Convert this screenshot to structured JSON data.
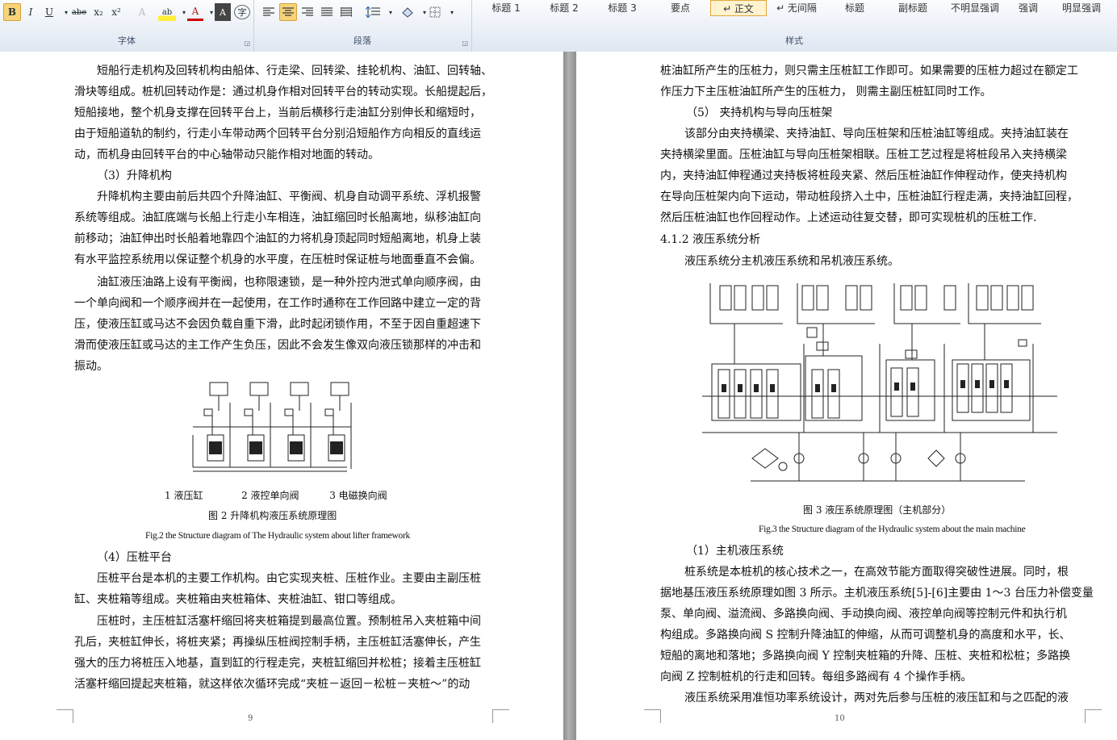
{
  "ribbon": {
    "font_group": {
      "label": "字体",
      "buttons": [
        "B",
        "I",
        "U",
        "abe",
        "x₂",
        "x²",
        "A",
        "ab",
        "A",
        "A",
        "字"
      ]
    },
    "paragraph_group": {
      "label": "段落"
    },
    "styles_group": {
      "label": "样式",
      "items": [
        "标题 1",
        "标题 2",
        "标题 3",
        "要点",
        "↵ 正文",
        "↵ 无间隔",
        "标题",
        "副标题",
        "不明显强调",
        "强调",
        "明显强调"
      ],
      "active_index": 4
    }
  },
  "left_page": {
    "lines": [
      "短船行走机构及回转机构由船体、行走梁、回转梁、挂轮机构、油缸、回转轴、",
      "滑块等组成。桩机回转动作是：通过机身作相对回转平台的转动实现。长船提起后，",
      "短船接地，整个机身支撑在回转平台上，当前后横移行走油缸分别伸长和缩短时，",
      "由于短船道轨的制约，行走小车带动两个回转平台分别沿短船作方向相反的直线运",
      "动，而机身由回转平台的中心轴带动只能作相对地面的转动。",
      "（3）升降机构",
      "升降机构主要由前后共四个升降油缸、平衡阀、机身自动调平系统、浮机报警",
      "系统等组成。油缸底端与长船上行走小车相连，油缸缩回时长船离地，纵移油缸向",
      "前移动；油缸伸出时长船着地靠四个油缸的力将机身顶起同时短船离地，机身上装",
      "有水平监控系统用以保证整个机身的水平度，在压桩时保证桩与地面垂直不会偏。",
      "油缸液压油路上设有平衡阀，也称限速锁，是一种外控内泄式单向顺序阀，由",
      "一个单向阀和一个顺序阀并在一起使用，在工作时通称在工作回路中建立一定的背",
      "压，使液压缸或马达不会因负载自重下滑，此时起闭锁作用，不至于因自重超速下",
      "滑而使液压缸或马达的主工作产生负压，因此不会发生像双向液压锁那样的冲击和",
      "振动。"
    ],
    "figure_legend": [
      "1  液压缸",
      "2  液控单向阀",
      "3  电磁换向阀"
    ],
    "figure_caption_cn": "图 2  升降机构液压系统原理图",
    "figure_caption_en": "Fig.2 the Structure diagram of The Hydraulic system about lifter framework",
    "lines_after": [
      "（4）压桩平台",
      "压桩平台是本机的主要工作机构。由它实现夹桩、压桩作业。主要由主副压桩",
      "缸、夹桩箱等组成。夹桩箱由夹桩箱体、夹桩油缸、钳口等组成。",
      "压桩时，主压桩缸活塞杆缩回将夹桩箱提到最高位置。预制桩吊入夹桩箱中间",
      "孔后，夹桩缸伸长，将桩夹紧；再操纵压桩阀控制手柄，主压桩缸活塞伸长，产生",
      "强大的压力将桩压入地基，直到缸的行程走完，夹桩缸缩回并松桩；接着主压桩缸",
      "活塞杆缩回提起夹桩箱，就这样依次循环完成“夹桩－返回－松桩－夹桩～”的动"
    ],
    "page_number": "9"
  },
  "right_page": {
    "lines": [
      "桩油缸所产生的压桩力，则只需主压桩缸工作即可。如果需要的压桩力超过在额定工",
      "作压力下主压桩油缸所产生的压桩力，   则需主副压桩缸同时工作。",
      "（5）  夹持机构与导向压桩架",
      "该部分由夹持横梁、夹持油缸、导向压桩架和压桩油缸等组成。夹持油缸装在",
      "夹持横梁里面。压桩油缸与导向压桩架相联。压桩工艺过程是将桩段吊入夹持横梁",
      "内，夹持油缸伸程通过夹持板将桩段夹紧、然后压桩油缸作伸程动作，使夹持机构",
      "在导向压桩架内向下运动，带动桩段挤入土中，压桩油缸行程走满，夹持油缸回程，",
      "然后压桩油缸也作回程动作。上述运动往复交替，即可实现桩机的压桩工作.",
      "4.1.2    液压系统分析",
      "液压系统分主机液压系统和吊机液压系统。"
    ],
    "figure_caption_cn": "图 3 液压系统原理图（主机部分）",
    "figure_caption_en": "Fig.3 the Structure diagram of the Hydraulic system about the main machine",
    "lines_after": [
      "（1）主机液压系统",
      "桩系统是本桩机的核心技术之一，在高效节能方面取得突破性进展。同时，根",
      "据地基压液压系统原理如图 3 所示。主机液压系统[5]-[6]主要由 1～3 台压力补偿变量",
      "泵、单向阀、溢流阀、多路换向阀、手动换向阀、液控单向阀等控制元件和执行机",
      "构组成。多路换向阀 S 控制升降油缸的伸缩，从而可调整机身的高度和水平，长、",
      "短船的离地和落地；多路换向阀 Y 控制夹桩箱的升降、压桩、夹桩和松桩；多路换",
      "向阀 Z 控制桩机的行走和回转。每组多路阀有 4 个操作手柄。",
      "液压系统采用准恒功率系统设计，两对先后参与压桩的液压缸和与之匹配的液"
    ],
    "page_number": "10"
  }
}
